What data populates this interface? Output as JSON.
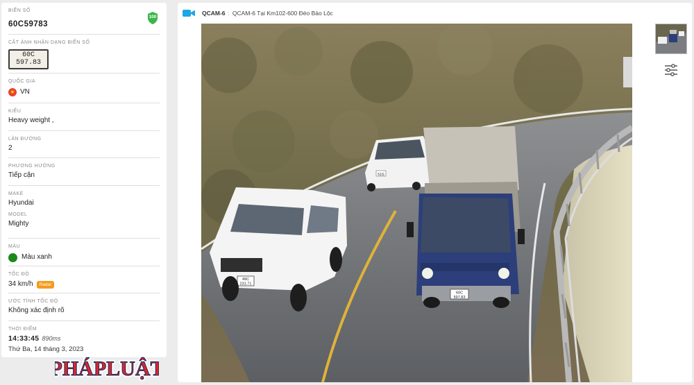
{
  "vehicle": {
    "plate_label": "BIỂN SỐ",
    "plate": "60C59783",
    "score": "100",
    "plate_crop_label": "CẮT ẢNH NHẬN DẠNG BIỂN SỐ",
    "plate_crop_line1": "60C",
    "plate_crop_line2": "597.83",
    "country_label": "QUỐC GIA",
    "country": "VN",
    "type_label": "KIỂU",
    "type": "Heavy weight ,",
    "lane_label": "LÀN ĐƯỜNG",
    "lane": "2",
    "direction_label": "PHƯƠNG HƯỚNG",
    "direction": "Tiếp cận",
    "make_label": "MAKE",
    "make": "Hyundai",
    "model_label": "MODEL",
    "model": "Mighty",
    "color_label": "MÀU",
    "color": "Màu xanh",
    "color_hex": "#1a8a1a",
    "speed_label": "TỐC ĐỘ",
    "speed": "34 km/h",
    "speed_source": "Radar",
    "speed_est_label": "ƯỚC TÍNH TỐC ĐỘ",
    "speed_est": "Không xác định rõ",
    "time_label": "THỜI ĐIỂM",
    "time": "14:33:45",
    "time_ms": "890ms",
    "date": "Thứ Ba, 14 tháng 3, 2023"
  },
  "camera": {
    "id": "QCAM-6",
    "separator": ":",
    "name": "QCAM-6 Tại Km102-600 Đèo Bảo Lộc",
    "icon": "video-camera-icon",
    "accent": "#1ea7e4"
  },
  "scene": {
    "truck_plate_line1": "60C",
    "truck_plate_line2": "597.83",
    "pickup_plate_line1": "49C",
    "pickup_plate_line2": "231.71",
    "car_plate": "51G"
  },
  "watermark": {
    "text": "PHÁPLUẬT"
  },
  "colors": {
    "score_badge": "#3cb54a",
    "radar_badge": "#f59a1c",
    "country_flag": "#e8412f"
  }
}
